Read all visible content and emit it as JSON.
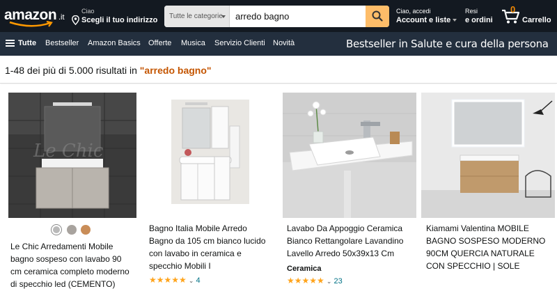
{
  "header": {
    "logo_text": "amazon",
    "logo_tld": ".it",
    "deliver_line1": "Ciao",
    "deliver_line2": "Scegli il tuo indirizzo",
    "search_category": "Tutte le categorie",
    "search_value": "arredo bagno",
    "account_line1": "Ciao, accedi",
    "account_line2": "Account e liste",
    "returns_line1": "Resi",
    "returns_line2": "e ordini",
    "cart_count": "0",
    "cart_label": "Carrello"
  },
  "subnav": {
    "all_label": "Tutte",
    "links": [
      "Bestseller",
      "Amazon Basics",
      "Offerte",
      "Musica",
      "Servizio Clienti",
      "Novità"
    ],
    "promo": "Bestseller in Salute e cura della persona"
  },
  "results": {
    "prefix": "1-48 dei più di 5.000 risultati in ",
    "query": "\"arredo bagno\""
  },
  "products": [
    {
      "title_lines": [
        "Le Chic Arredamenti Mobile",
        "bagno sospeso con lavabo 90",
        "cm ceramica completo moderno",
        "di specchio led (CEMENTO)"
      ],
      "swatches": [
        "#b9b9b9",
        "#a8a39e",
        "#c98d58"
      ]
    },
    {
      "title_lines": [
        "Bagno Italia Mobile Arredo",
        "Bagno da 105 cm bianco lucido",
        "con lavabo in ceramica e",
        "specchio Mobili I"
      ],
      "stars": "★★★★★",
      "rating_count": "4"
    },
    {
      "title_lines": [
        "Lavabo Da Appoggio Ceramica",
        "Bianco Rettangolare Lavandino",
        "Lavello Arredo 50x39x13 Cm"
      ],
      "brand": "Ceramica",
      "stars": "★★★★★",
      "rating_count": "23"
    },
    {
      "title_lines": [
        "Kiamami Valentina MOBILE",
        "BAGNO SOSPESO MODERNO",
        "90CM QUERCIA NATURALE",
        "CON SPECCHIO | SOLE"
      ]
    }
  ],
  "colors": {
    "nav_top": "#131921",
    "nav_sub": "#232f3e",
    "search_button": "#febd69",
    "query_accent": "#c45500",
    "link": "#007185",
    "stars": "#ffa41c"
  }
}
